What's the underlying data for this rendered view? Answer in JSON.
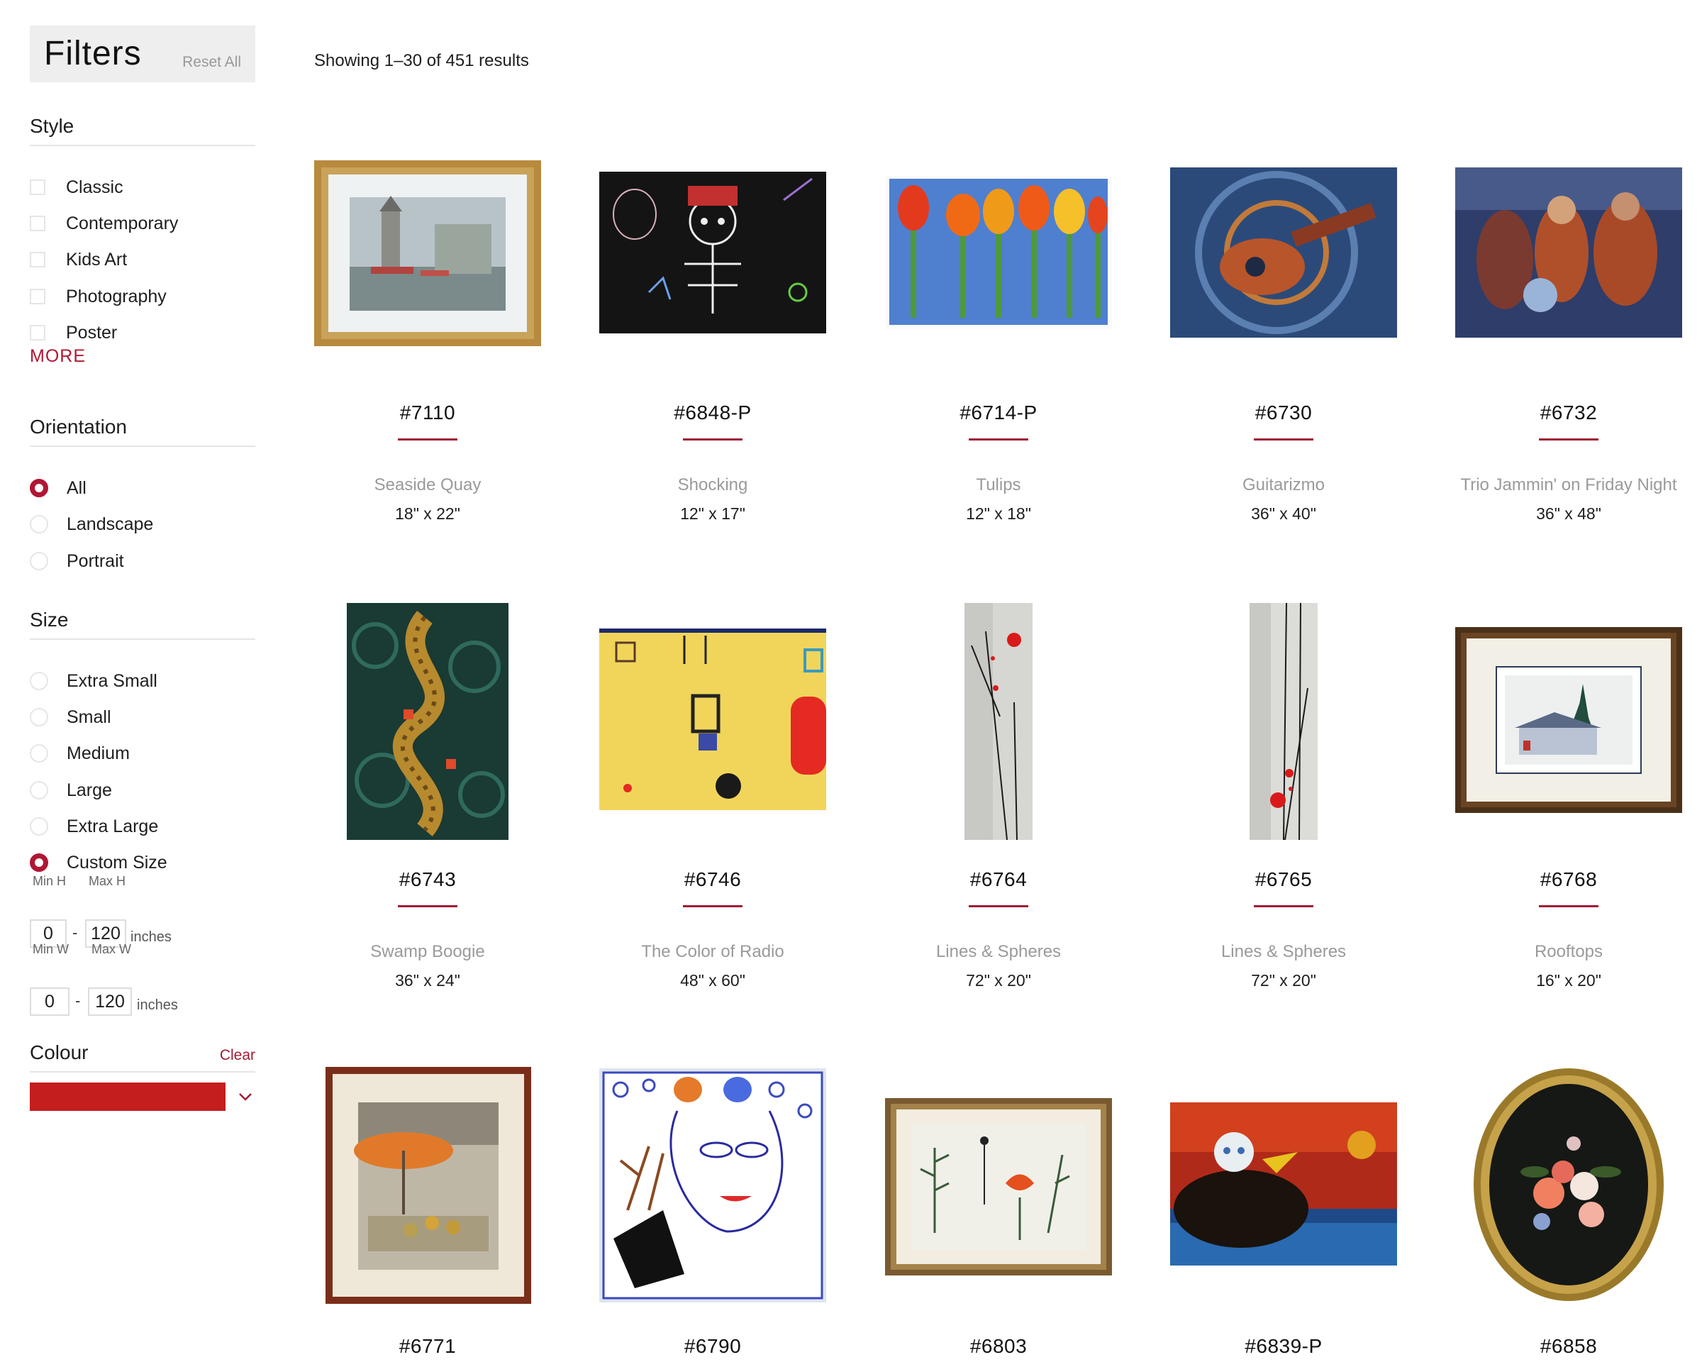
{
  "sidebar": {
    "title": "Filters",
    "reset_label": "Reset All",
    "style": {
      "heading": "Style",
      "options": [
        "Classic",
        "Contemporary",
        "Kids Art",
        "Photography",
        "Poster"
      ],
      "more_label": "MORE"
    },
    "orientation": {
      "heading": "Orientation",
      "options": [
        "All",
        "Landscape",
        "Portrait"
      ],
      "selected": "All"
    },
    "size": {
      "heading": "Size",
      "options": [
        "Extra Small",
        "Small",
        "Medium",
        "Large",
        "Extra Large",
        "Custom Size"
      ],
      "selected": "Custom Size",
      "min_h_label": "Min H",
      "max_h_label": "Max H",
      "min_h": "0",
      "max_h": "120",
      "min_w_label": "Min W",
      "max_w_label": "Max W",
      "min_w": "0",
      "max_w": "120",
      "unit": "inches"
    },
    "colour": {
      "heading": "Colour",
      "clear_label": "Clear",
      "selected_color": "#c41e1e"
    }
  },
  "results": {
    "summary": "Showing 1–30 of 451 results",
    "accent_color": "#a01c34",
    "items": [
      {
        "sku": "#7110",
        "title": "Seaside Quay",
        "size": "18\" x 22\""
      },
      {
        "sku": "#6848-P",
        "title": "Shocking",
        "size": "12\" x 17\""
      },
      {
        "sku": "#6714-P",
        "title": "Tulips",
        "size": "12\" x 18\""
      },
      {
        "sku": "#6730",
        "title": "Guitarizmo",
        "size": "36\" x 40\""
      },
      {
        "sku": "#6732",
        "title": "Trio Jammin' on Friday Night",
        "size": "36\" x 48\""
      },
      {
        "sku": "#6743",
        "title": "Swamp Boogie",
        "size": "36\" x 24\""
      },
      {
        "sku": "#6746",
        "title": "The Color of Radio",
        "size": "48\" x 60\""
      },
      {
        "sku": "#6764",
        "title": "Lines & Spheres",
        "size": "72\" x 20\""
      },
      {
        "sku": "#6765",
        "title": "Lines & Spheres",
        "size": "72\" x 20\""
      },
      {
        "sku": "#6768",
        "title": "Rooftops",
        "size": "16\" x 20\""
      },
      {
        "sku": "#6771"
      },
      {
        "sku": "#6790"
      },
      {
        "sku": "#6803"
      },
      {
        "sku": "#6839-P"
      },
      {
        "sku": "#6858"
      }
    ]
  }
}
